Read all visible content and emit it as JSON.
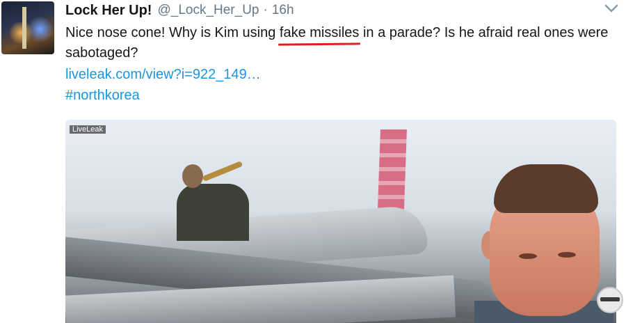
{
  "tweet": {
    "display_name": "Lock Her Up!",
    "handle": "@_Lock_Her_Up",
    "separator": "·",
    "time": "16h",
    "text_before": "Nice nose cone!  Why is Kim using ",
    "text_highlight": "fake missiles",
    "text_after": " in a parade?  Is he afraid real ones were sabotaged?",
    "link": "liveleak.com/view?i=922_149…",
    "hashtag": "#northkorea"
  },
  "media": {
    "watermark": "LiveLeak"
  },
  "icons": {
    "menu": "chevron-down-icon",
    "avatar": "avatar-image",
    "badge": "channel-badge-icon"
  },
  "colors": {
    "link": "#1b95e0",
    "name": "#14171a",
    "meta": "#657786",
    "annotation": "#e0201c"
  }
}
